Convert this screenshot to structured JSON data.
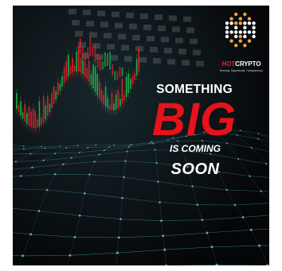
{
  "brand": {
    "name_part1": "HOT",
    "name_part2": "CRYPTO",
    "tagline": "Honesty. Opportunity. Transparency.",
    "accent_color": "#e8232a",
    "mark_color": "#f2a13a"
  },
  "headline": {
    "line1": "SOMETHING",
    "line2": "BIG",
    "line3": "IS COMING",
    "line4": "SOON"
  },
  "background": {
    "description_icon": "candlestick-chart-icon",
    "candle_up_color": "#1fb84a",
    "candle_down_color": "#e0242c",
    "mesh_color": "#3fa6b8"
  }
}
